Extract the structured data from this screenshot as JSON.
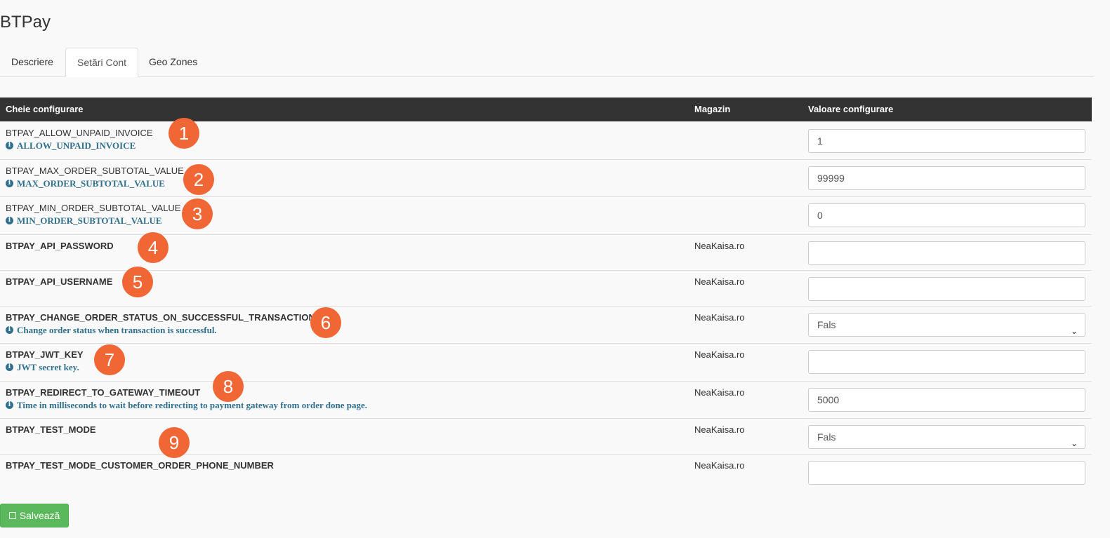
{
  "page": {
    "title": "BTPay"
  },
  "tabs": [
    {
      "label": "Descriere"
    },
    {
      "label": "Setări Cont"
    },
    {
      "label": "Geo Zones"
    }
  ],
  "table": {
    "headers": {
      "key": "Cheie configurare",
      "store": "Magazin",
      "value": "Valoare configurare"
    },
    "rows": [
      {
        "key": "BTPAY_ALLOW_UNPAID_INVOICE",
        "desc": "ALLOW_UNPAID_INVOICE",
        "store": "",
        "value": "1"
      },
      {
        "key": "BTPAY_MAX_ORDER_SUBTOTAL_VALUE",
        "desc": "MAX_ORDER_SUBTOTAL_VALUE",
        "store": "",
        "value": "99999"
      },
      {
        "key": "BTPAY_MIN_ORDER_SUBTOTAL_VALUE",
        "desc": "MIN_ORDER_SUBTOTAL_VALUE",
        "store": "",
        "value": "0"
      },
      {
        "key": "BTPAY_API_PASSWORD",
        "desc": "",
        "store": "NeaKaisa.ro",
        "value": ""
      },
      {
        "key": "BTPAY_API_USERNAME",
        "desc": "",
        "store": "NeaKaisa.ro",
        "value": ""
      },
      {
        "key": "BTPAY_CHANGE_ORDER_STATUS_ON_SUCCESSFUL_TRANSACTION",
        "desc": "Change order status when transaction is successful.",
        "store": "NeaKaisa.ro",
        "value": "Fals"
      },
      {
        "key": "BTPAY_JWT_KEY",
        "desc": "JWT secret key.",
        "store": "NeaKaisa.ro",
        "value": ""
      },
      {
        "key": "BTPAY_REDIRECT_TO_GATEWAY_TIMEOUT",
        "desc": "Time in milliseconds to wait before redirecting to payment gateway from order done page.",
        "store": "NeaKaisa.ro",
        "value": "5000"
      },
      {
        "key": "BTPAY_TEST_MODE",
        "desc": "",
        "store": "NeaKaisa.ro",
        "value": "Fals"
      },
      {
        "key": "BTPAY_TEST_MODE_CUSTOMER_ORDER_PHONE_NUMBER",
        "desc": "",
        "store": "NeaKaisa.ro",
        "value": ""
      }
    ]
  },
  "markers": [
    "1",
    "2",
    "3",
    "4",
    "5",
    "6",
    "7",
    "8",
    "9"
  ],
  "save_button": {
    "label": "Salvează"
  },
  "colors": {
    "header_bg": "#333333",
    "marker": "#f06635",
    "info_text": "#31708f",
    "save_green": "#5cb85c"
  }
}
